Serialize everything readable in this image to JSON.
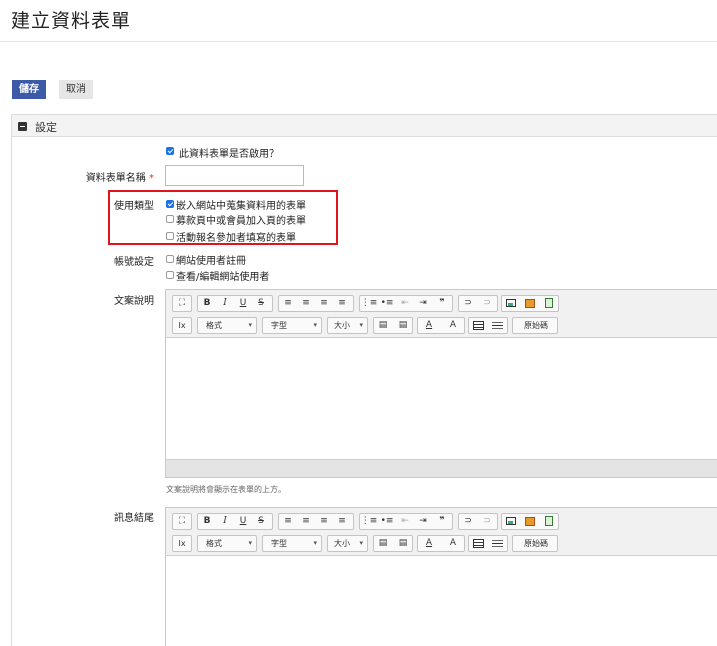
{
  "page": {
    "title": "建立資料表單"
  },
  "actions": {
    "save_label": "儲存",
    "cancel_label": "取消"
  },
  "settings": {
    "section_title": "設定",
    "enabled": {
      "label": "此資料表單是否啟用？",
      "checked": true
    },
    "form_name": {
      "label": "資料表單名稱",
      "required_mark": "*",
      "value": ""
    },
    "usage_type": {
      "label": "使用類型",
      "options": [
        {
          "label": "嵌入網站中蒐集資料用的表單",
          "checked": true
        },
        {
          "label": "募款頁中或會員加入頁的表單",
          "checked": false
        },
        {
          "label": "活動報名參加者填寫的表單",
          "checked": false
        }
      ]
    },
    "account": {
      "label": "帳號設定",
      "options": [
        {
          "label": "網站使用者註冊",
          "checked": false
        },
        {
          "label": "查看/編輯網站使用者",
          "checked": false
        }
      ]
    },
    "description": {
      "label": "文案說明",
      "hint": "文案說明將會顯示在表單的上方。"
    },
    "message": {
      "label": "訊息結尾"
    }
  },
  "editor": {
    "toolbar": {
      "maximize": "⛶",
      "bold": "B",
      "italic": "I",
      "underline": "U",
      "strike": "S",
      "align_left": "≡",
      "align_center": "≡",
      "align_right": "≡",
      "justify": "≡",
      "ordered_list": "⋮≡",
      "bullet_list": "•≡",
      "outdent": "⇤",
      "indent": "⇥",
      "blockquote": "❞",
      "link": "⊃",
      "unlink": "⊃",
      "remove_format": "Ix",
      "format_label": "格式",
      "font_label": "字型",
      "size_label": "大小",
      "paste": "▤",
      "paste_text": "▤",
      "text_color": "A",
      "bg_color": "A",
      "source_label": "原始碼",
      "caret": "▾"
    }
  }
}
